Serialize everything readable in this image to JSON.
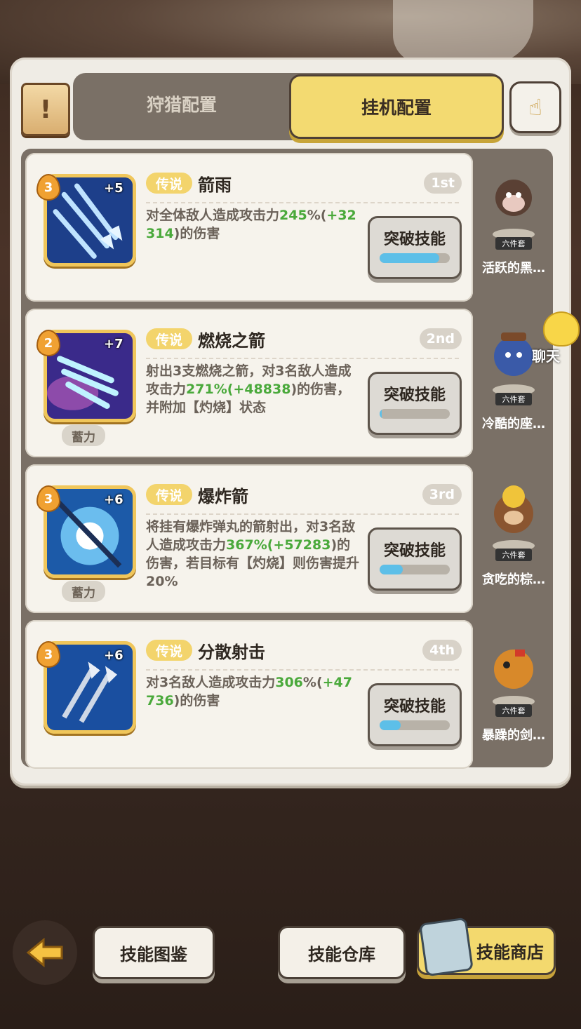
{
  "tabs": {
    "hunt": "狩猎配置",
    "idle": "挂机配置"
  },
  "skills": [
    {
      "level": "3",
      "plus": "+5",
      "rarity": "传说",
      "name": "箭雨",
      "rank": "1st",
      "desc_a": "对全体敌人造成攻击力",
      "desc_pct": "245",
      "desc_b": "%(",
      "desc_bonus": "+32314",
      "desc_c": ")的伤害",
      "charge": "",
      "button": "突破技能",
      "progress": 0.85
    },
    {
      "level": "2",
      "plus": "+7",
      "rarity": "传说",
      "name": "燃烧之箭",
      "rank": "2nd",
      "desc_a": "射出3支燃烧之箭，对3名敌人造成攻击力",
      "desc_pct": "271",
      "desc_b": "%(",
      "desc_bonus": "+48838",
      "desc_c": ")的伤害，并附加【灼烧】状态",
      "charge": "蓄力",
      "button": "突破技能",
      "progress": 0.03
    },
    {
      "level": "3",
      "plus": "+6",
      "rarity": "传说",
      "name": "爆炸箭",
      "rank": "3rd",
      "desc_a": "将挂有爆炸弹丸的箭射出，对3名敌人造成攻击力",
      "desc_pct": "367",
      "desc_b": "%(",
      "desc_bonus": "+57283",
      "desc_c": ")的伤害，若目标有【灼烧】则伤害提升20%",
      "charge": "蓄力",
      "button": "突破技能",
      "progress": 0.33
    },
    {
      "level": "3",
      "plus": "+6",
      "rarity": "传说",
      "name": "分散射击",
      "rank": "4th",
      "desc_a": "对3名敌人造成攻击力",
      "desc_pct": "306",
      "desc_b": "%(",
      "desc_bonus": "+47736",
      "desc_c": ")的伤害",
      "charge": "",
      "button": "突破技能",
      "progress": 0.3
    }
  ],
  "pets": [
    {
      "tag": "六件套",
      "name": "活跃的黑…"
    },
    {
      "tag": "六件套",
      "name": "冷酷的座…"
    },
    {
      "tag": "六件套",
      "name": "贪吃的棕…"
    },
    {
      "tag": "六件套",
      "name": "暴躁的剑…"
    }
  ],
  "chat": "聊天",
  "bottom": {
    "compendium": "技能图鉴",
    "warehouse": "技能仓库",
    "shop": "技能商店"
  }
}
